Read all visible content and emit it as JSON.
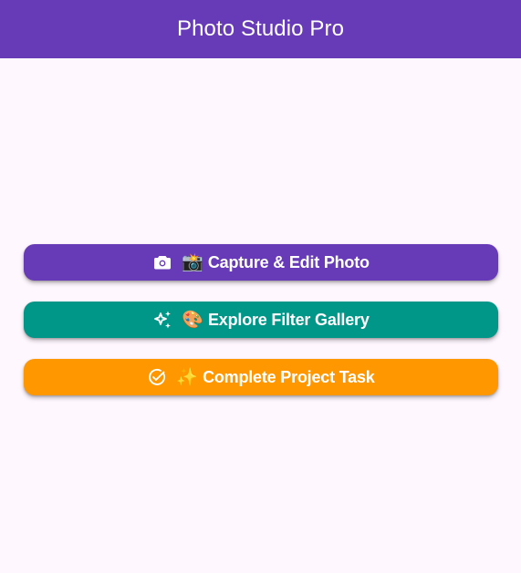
{
  "appbar": {
    "title": "Photo Studio Pro"
  },
  "actions": [
    {
      "icon": "camera-icon",
      "emoji": "📸",
      "label": "Capture & Edit Photo",
      "color": "#673ab7"
    },
    {
      "icon": "sparkle-icon",
      "emoji": "🎨",
      "label": "Explore Filter Gallery",
      "color": "#009688"
    },
    {
      "icon": "check-circle-icon",
      "emoji": "✨",
      "label": "Complete Project Task",
      "color": "#ff9800"
    }
  ],
  "colors": {
    "appbar": "#673ab7",
    "background": "#fff7fe",
    "text_on_primary": "#ffffff"
  }
}
